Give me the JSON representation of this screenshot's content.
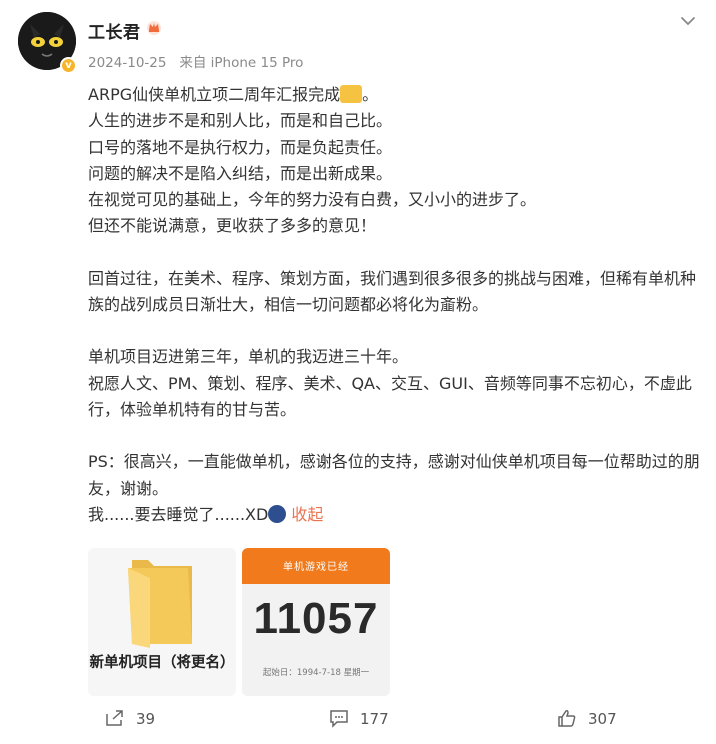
{
  "post": {
    "author": "工长君",
    "date": "2024-10-25",
    "source": "来自 iPhone 15 Pro",
    "lines_block1": [
      "ARPG仙侠单机立项二周年汇报完成",
      "人生的进步不是和别人比，而是和自己比。",
      "口号的落地不是执行权力，而是负起责任。",
      "问题的解决不是陷入纠结，而是出新成果。",
      "在视觉可见的基础上，今年的努力没有白费，又小小的进步了。",
      "但还不能说满意，更收获了多多的意见！"
    ],
    "line1_tail": "。",
    "paragraph2": "回首过往，在美术、程序、策划方面，我们遇到很多很多的挑战与困难，但稀有单机种族的战列成员日渐壮大，相信一切问题都必将化为齑粉。",
    "paragraph3_line1": "单机项目迈进第三年，单机的我迈进三十年。",
    "paragraph3_line2": "祝愿人文、PM、策划、程序、美术、QA、交互、GUI、音频等同事不忘初心，不虚此行，体验单机特有的甘与苦。",
    "paragraph4": "PS：很高兴，一直能做单机，感谢各位的支持，感谢对仙侠单机项目每一位帮助过的朋友，谢谢。",
    "last_line": "我......要去睡觉了......XD",
    "collapse": "收起"
  },
  "images": {
    "folder_caption": "新单机项目（将更名）",
    "counter_title": "单机游戏已经",
    "counter_value": "11057",
    "counter_since": "起始日：1994-7-18 星期一"
  },
  "actions": {
    "share_count": "39",
    "comment_count": "177",
    "like_count": "307"
  },
  "icons": [
    "chevron-down-icon",
    "verified-badge-icon",
    "crown-icon",
    "share-icon",
    "comment-icon",
    "like-icon",
    "folder-icon"
  ],
  "colors": {
    "accent": "#eb7350",
    "counter_header": "#f07a1c",
    "folder": "#f5c85a"
  }
}
